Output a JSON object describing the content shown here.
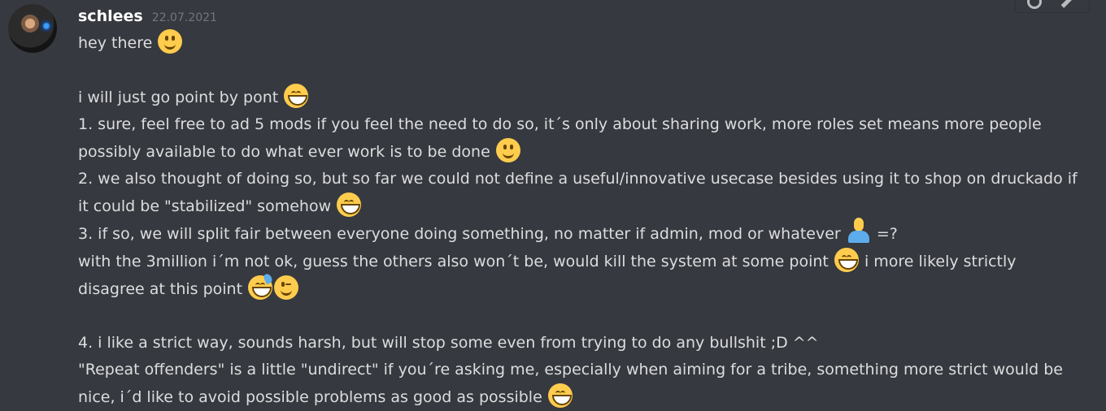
{
  "message": {
    "author": "schlees",
    "timestamp": "22.07.2021",
    "lines": [
      "hey there",
      "",
      "i will just go point by pont",
      "1. sure, feel free to ad 5 mods if you feel the need to do so, it´s only about sharing work, more roles set means more people possibly available to do what ever work is to be done",
      "2. we also thought of doing so, but so far we could not define a useful/innovative usecase besides using it to shop on druckado if it could be \"stabilized\" somehow",
      "3. if so, we will split fair between everyone doing something, no matter if admin, mod or whatever",
      "=?",
      "with the 3million i´m not ok, guess the others also won´t be, would kill the system at some point",
      "i more likely strictly disagree at this point",
      "4. i like a strict way, sounds harsh, but will stop some even from trying to do any bullshit ;D ^^",
      "\"Repeat offenders\" is a little \"undirect\" if you´re asking me, especially when aiming for a tribe, something more strict would be nice, i´d like to avoid possible problems as good as possible"
    ],
    "emojis": [
      "slightly-smiling-face",
      "grinning-face-smiling-eyes",
      "slightly-smiling-face",
      "grinning-face-smiling-eyes",
      "person-shrugging",
      "grinning-face-smiling-eyes",
      "grinning-face-with-sweat",
      "winking-face",
      "grinning-face-smiling-eyes"
    ]
  },
  "colors": {
    "background": "#36393f",
    "username": "#ffffff",
    "timestamp": "#72767d",
    "text": "#dcddde"
  }
}
